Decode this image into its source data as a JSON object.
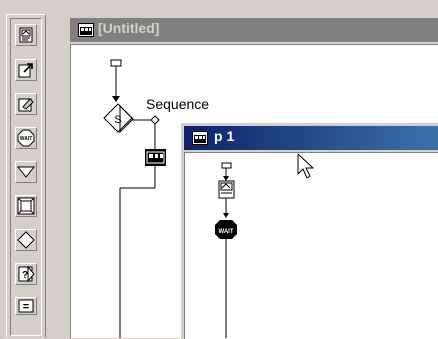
{
  "palette": {
    "tools": [
      {
        "icon": "display-icon"
      },
      {
        "icon": "motion-arrow-icon"
      },
      {
        "icon": "erase-icon"
      },
      {
        "icon": "wait-icon",
        "text": "WAIT"
      },
      {
        "icon": "navigate-triangle-icon"
      },
      {
        "icon": "framework-icon"
      },
      {
        "icon": "decision-diamond-icon"
      },
      {
        "icon": "interaction-icon",
        "text": "?"
      },
      {
        "icon": "calculation-icon",
        "text": "="
      }
    ]
  },
  "main_window": {
    "title": "[Untitled]",
    "sequence_label": "Sequence",
    "decision_icon_text": "S"
  },
  "sub_window": {
    "title": "p 1",
    "wait_text": "WAIT"
  },
  "colors": {
    "inactive_title": "#808080",
    "active_title_start": "#0a246a",
    "active_title_end": "#3a6ea5",
    "face": "#d4d0c8"
  }
}
